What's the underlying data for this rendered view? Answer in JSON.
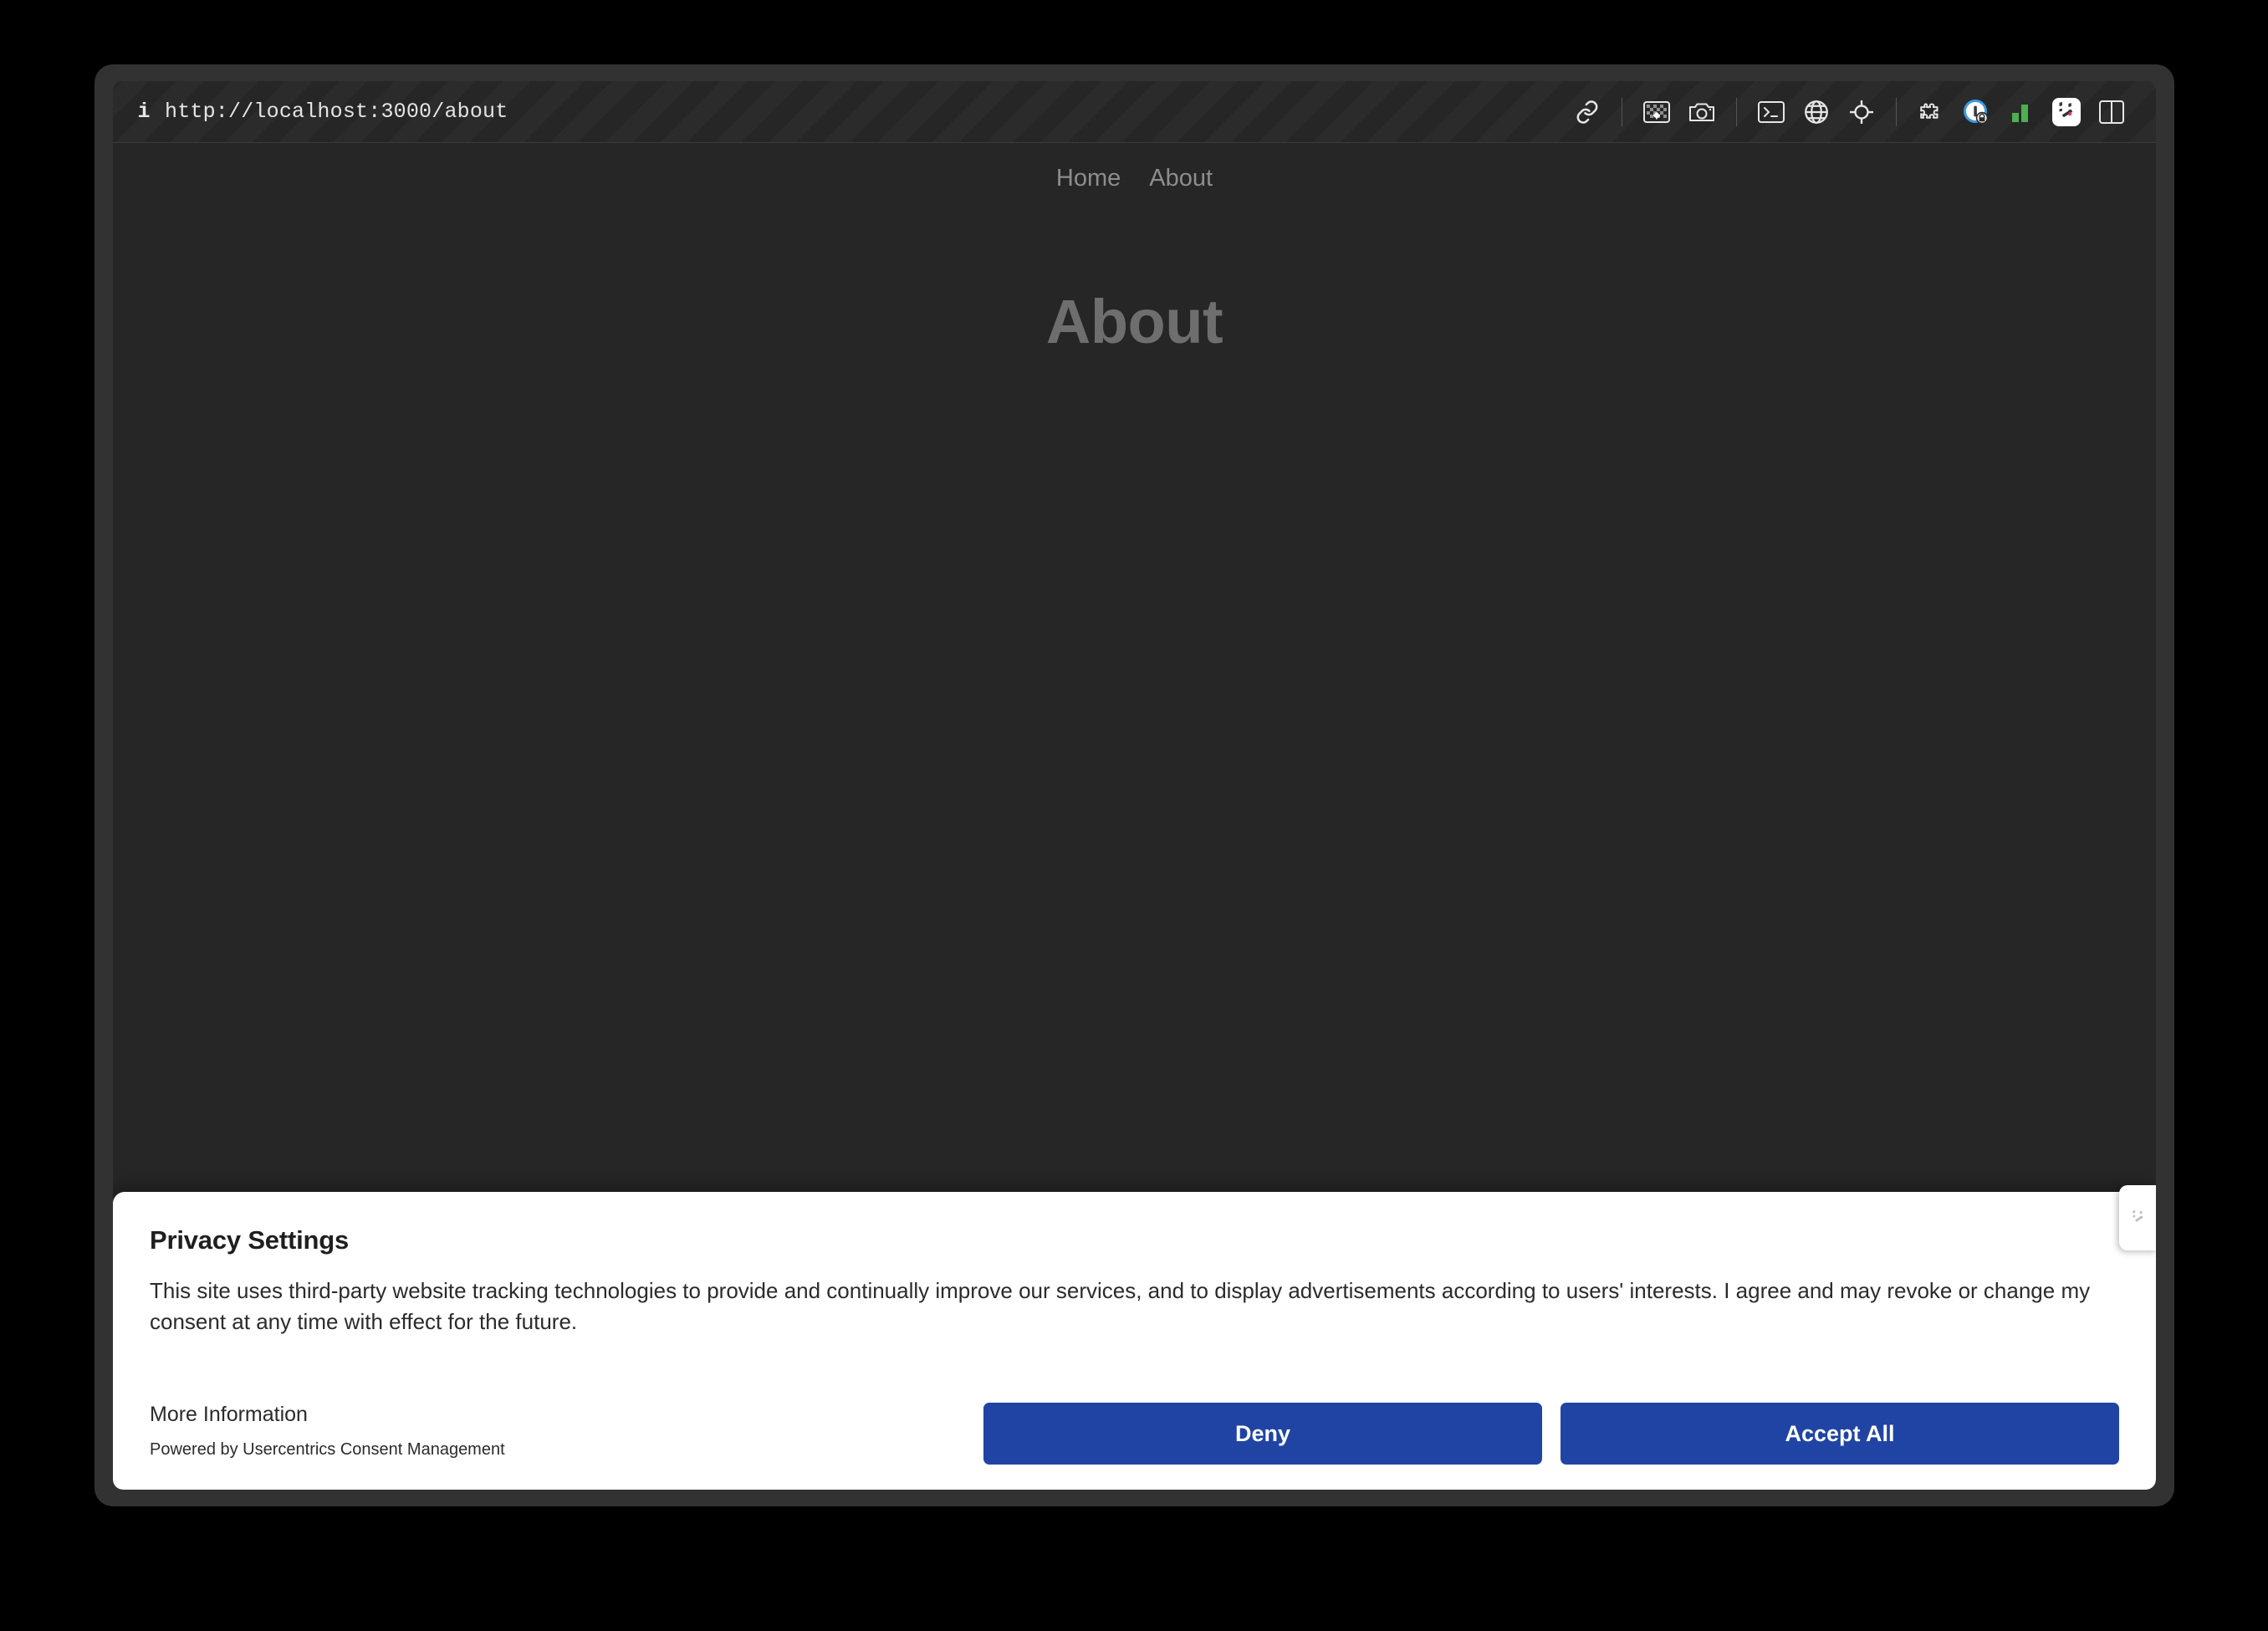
{
  "browser": {
    "url": "http://localhost:3000/about",
    "info_icon": "info-icon",
    "toolbar_icons": [
      {
        "name": "link-icon"
      },
      {
        "name": "separator"
      },
      {
        "name": "image-placeholder-icon"
      },
      {
        "name": "camera-icon"
      },
      {
        "name": "separator"
      },
      {
        "name": "terminal-icon"
      },
      {
        "name": "globe-icon"
      },
      {
        "name": "crosshair-target-icon"
      },
      {
        "name": "separator"
      },
      {
        "name": "puzzle-piece-icon"
      },
      {
        "name": "privacy-badge-icon"
      },
      {
        "name": "green-bars-icon"
      },
      {
        "name": "app-logo-icon"
      },
      {
        "name": "split-view-icon"
      }
    ]
  },
  "site": {
    "nav": [
      {
        "label": "Home"
      },
      {
        "label": "About"
      }
    ],
    "page_title": "About"
  },
  "consent": {
    "title": "Privacy Settings",
    "body": "This site uses third-party website tracking technologies to provide and continually improve our services, and to display advertisements according to users' interests. I agree and may revoke or change my consent at any time with effect for the future.",
    "more_information": "More Information",
    "powered_by": "Powered by Usercentrics Consent Management",
    "deny_label": "Deny",
    "accept_label": "Accept All",
    "side_tab_icon": "app-logo-icon"
  },
  "colors": {
    "button_blue": "#1f44a3",
    "page_background": "#262626",
    "dialog_background": "#ffffff",
    "nav_text": "#8d8d8d",
    "heading_text": "#6e6e6e",
    "green_accent": "#4caf50",
    "privacy_badge_blue": "#3b9ae1",
    "logo_pink": "#e8336d"
  }
}
